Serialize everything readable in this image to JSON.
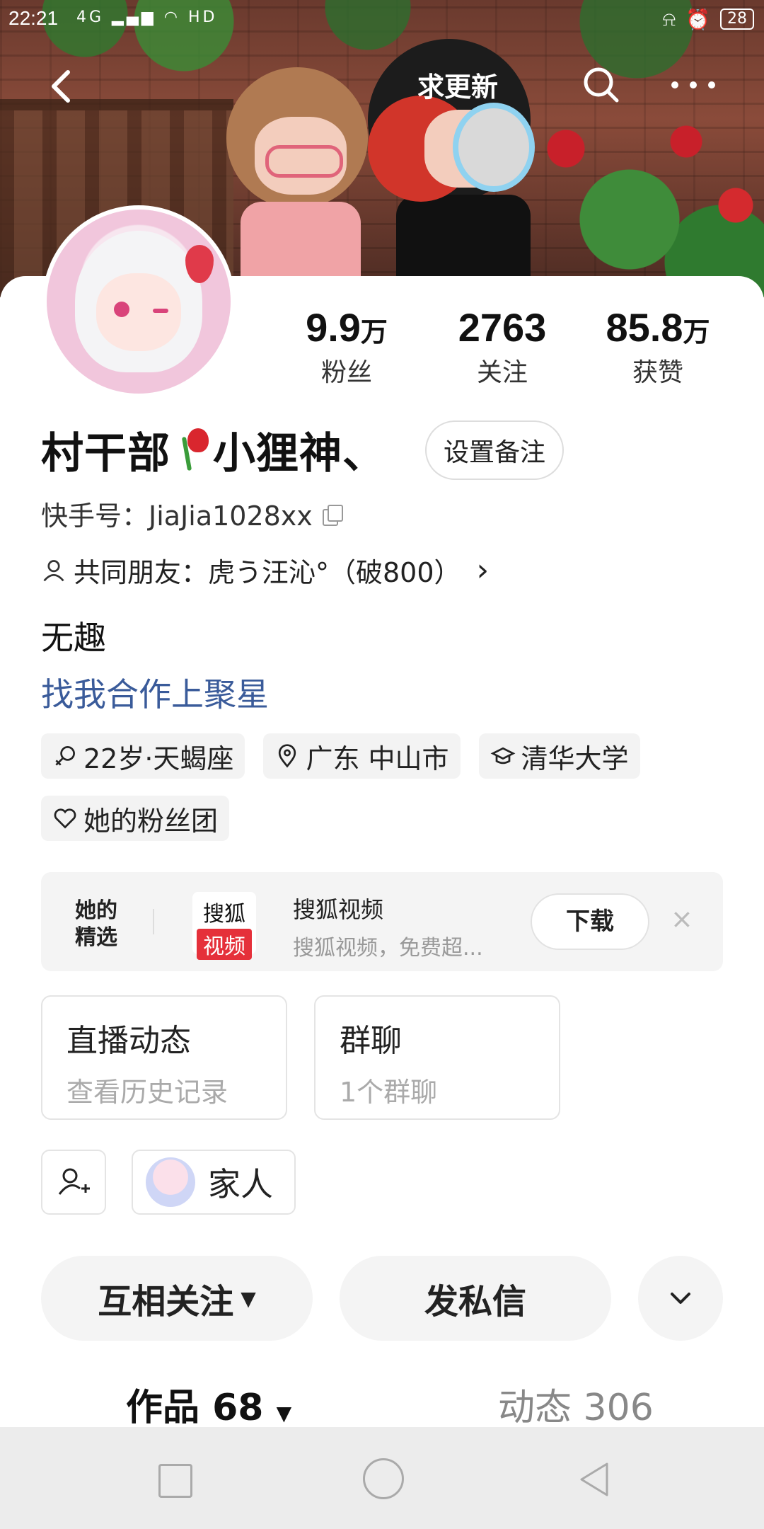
{
  "status_bar": {
    "time": "22:21",
    "signal": "4G",
    "wifi": "HD",
    "battery": "28"
  },
  "nav": {
    "update_label": "求更新",
    "icons": [
      "back-arrow-icon",
      "search-icon",
      "more-icon"
    ]
  },
  "stats": [
    {
      "value": "9.9",
      "unit": "万",
      "label": "粉丝"
    },
    {
      "value": "2763",
      "unit": "",
      "label": "关注"
    },
    {
      "value": "85.8",
      "unit": "万",
      "label": "获赞"
    }
  ],
  "profile": {
    "name_part1": "村干部",
    "name_part2": "小狸神、",
    "remark_label": "设置备注",
    "kuaishou_id": "快手号：JiaJia1028xx",
    "mutual_friends": "共同朋友：虎う汪沁°（破800）",
    "bio": "无趣",
    "link": "找我合作上聚星"
  },
  "tags": [
    {
      "icon": "gender-female-icon",
      "label": "22岁·天蝎座"
    },
    {
      "icon": "location-pin-icon",
      "label": "广东 中山市"
    },
    {
      "icon": "graduation-cap-icon",
      "label": "清华大学"
    },
    {
      "icon": "heart-outline-icon",
      "label": "她的粉丝团"
    }
  ],
  "promo": {
    "section_label": "她的精选",
    "logo_top": "搜狐",
    "logo_bottom": "视频",
    "title": "搜狐视频",
    "desc": "搜狐视频，免费超...",
    "download_label": "下载",
    "close_glyph": "×"
  },
  "cards": [
    {
      "title": "直播动态",
      "subtitle": "查看历史记录"
    },
    {
      "title": "群聊",
      "subtitle": "1个群聊"
    }
  ],
  "family": {
    "label": "家人"
  },
  "actions": {
    "follow_label": "互相关注",
    "message_label": "发私信"
  },
  "tabs": {
    "works_label": "作品 68",
    "moments_label": "动态 306"
  },
  "colors": {
    "link": "#3a5b9a",
    "promo_logo_red": "#e5303a",
    "pill_bg": "#f4f4f4",
    "sysnav_bg": "#ececec"
  }
}
